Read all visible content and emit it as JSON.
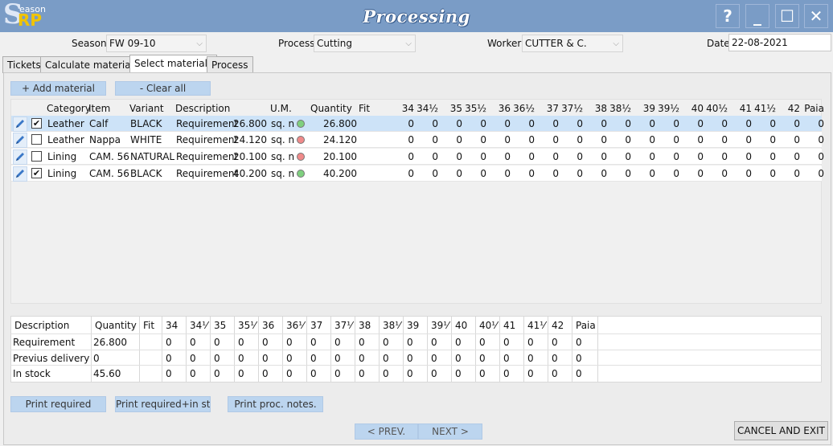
{
  "window": {
    "logo": {
      "s": "S",
      "eason": "eason",
      "rp": "RP"
    },
    "title": "Processing",
    "help_label": "?",
    "minimize_label": "_",
    "maximize_label": "☐",
    "close_label": "✕"
  },
  "filters": {
    "season_label": "Season",
    "season_value": "FW 09-10",
    "process_label": "Process",
    "process_value": "Cutting",
    "worker_label": "Worker",
    "worker_value": "CUTTER & C.",
    "date_label": "Date",
    "date_value": "22-08-2021"
  },
  "tabs": [
    "Tickets",
    "Calculate materials",
    "Select materials",
    "Process"
  ],
  "toolbar": {
    "add_label": "+ Add material",
    "clear_label": "- Clear all"
  },
  "materials": {
    "headers": {
      "category": "Category",
      "item": "Item",
      "variant": "Variant",
      "description": "Description",
      "um": "U.M.",
      "quantity": "Quantity",
      "fit": "Fit",
      "sizes": [
        "34",
        "34½",
        "35",
        "35½",
        "36",
        "36½",
        "37",
        "37½",
        "38",
        "38½",
        "39",
        "39½",
        "40",
        "40½",
        "41",
        "41½",
        "42",
        "Paia"
      ]
    },
    "rows": [
      {
        "checked": "✔",
        "category": "Leather",
        "item": "Calf",
        "variant": "BLACK",
        "description": "Requirement",
        "value": "26.800",
        "um": "sq. n",
        "status_color": "#7fd07f",
        "quantity": "26.800",
        "sizes": [
          "0",
          "0",
          "0",
          "0",
          "0",
          "0",
          "0",
          "0",
          "0",
          "0",
          "0",
          "0",
          "0",
          "0",
          "0",
          "0",
          "0",
          "0"
        ]
      },
      {
        "checked": "",
        "category": "Leather",
        "item": "Nappa",
        "variant": "WHITE",
        "description": "Requirement",
        "value": "24.120",
        "um": "sq. n",
        "status_color": "#f08a8a",
        "quantity": "24.120",
        "sizes": [
          "0",
          "0",
          "0",
          "0",
          "0",
          "0",
          "0",
          "0",
          "0",
          "0",
          "0",
          "0",
          "0",
          "0",
          "0",
          "0",
          "0",
          "0"
        ]
      },
      {
        "checked": "",
        "category": "Lining",
        "item": "CAM. 56",
        "variant": "NATURAL",
        "description": "Requirement",
        "value": "20.100",
        "um": "sq. n",
        "status_color": "#f08a8a",
        "quantity": "20.100",
        "sizes": [
          "0",
          "0",
          "0",
          "0",
          "0",
          "0",
          "0",
          "0",
          "0",
          "0",
          "0",
          "0",
          "0",
          "0",
          "0",
          "0",
          "0",
          "0"
        ]
      },
      {
        "checked": "✔",
        "category": "Lining",
        "item": "CAM. 56",
        "variant": "BLACK",
        "description": "Requirement",
        "value": "40.200",
        "um": "sq. n",
        "status_color": "#7fd07f",
        "quantity": "40.200",
        "sizes": [
          "0",
          "0",
          "0",
          "0",
          "0",
          "0",
          "0",
          "0",
          "0",
          "0",
          "0",
          "0",
          "0",
          "0",
          "0",
          "0",
          "0",
          "0"
        ]
      }
    ]
  },
  "summary": {
    "headers": {
      "description": "Description",
      "quantity": "Quantity",
      "fit": "Fit",
      "sizes": [
        "34",
        "34⅟",
        "35",
        "35⅟",
        "36",
        "36⅟",
        "37",
        "37⅟",
        "38",
        "38⅟",
        "39",
        "39⅟",
        "40",
        "40⅟",
        "41",
        "41⅟",
        "42",
        "Paia"
      ]
    },
    "rows": [
      {
        "description": "Requirement",
        "quantity": "26.800",
        "sizes": [
          "0",
          "0",
          "0",
          "0",
          "0",
          "0",
          "0",
          "0",
          "0",
          "0",
          "0",
          "0",
          "0",
          "0",
          "0",
          "0",
          "0",
          "0"
        ]
      },
      {
        "description": "Previus delivery",
        "quantity": "0",
        "sizes": [
          "0",
          "0",
          "0",
          "0",
          "0",
          "0",
          "0",
          "0",
          "0",
          "0",
          "0",
          "0",
          "0",
          "0",
          "0",
          "0",
          "0",
          "0"
        ]
      },
      {
        "description": "In stock",
        "quantity": "45.60",
        "sizes": [
          "0",
          "0",
          "0",
          "0",
          "0",
          "0",
          "0",
          "0",
          "0",
          "0",
          "0",
          "0",
          "0",
          "0",
          "0",
          "0",
          "0",
          "0"
        ]
      }
    ]
  },
  "actions": {
    "print_required": "Print required",
    "print_required_stock": "Print required+in stoc",
    "print_notes": "Print proc. notes.",
    "prev": "< PREV.",
    "next": "NEXT >",
    "cancel": "CANCEL AND EXIT"
  }
}
